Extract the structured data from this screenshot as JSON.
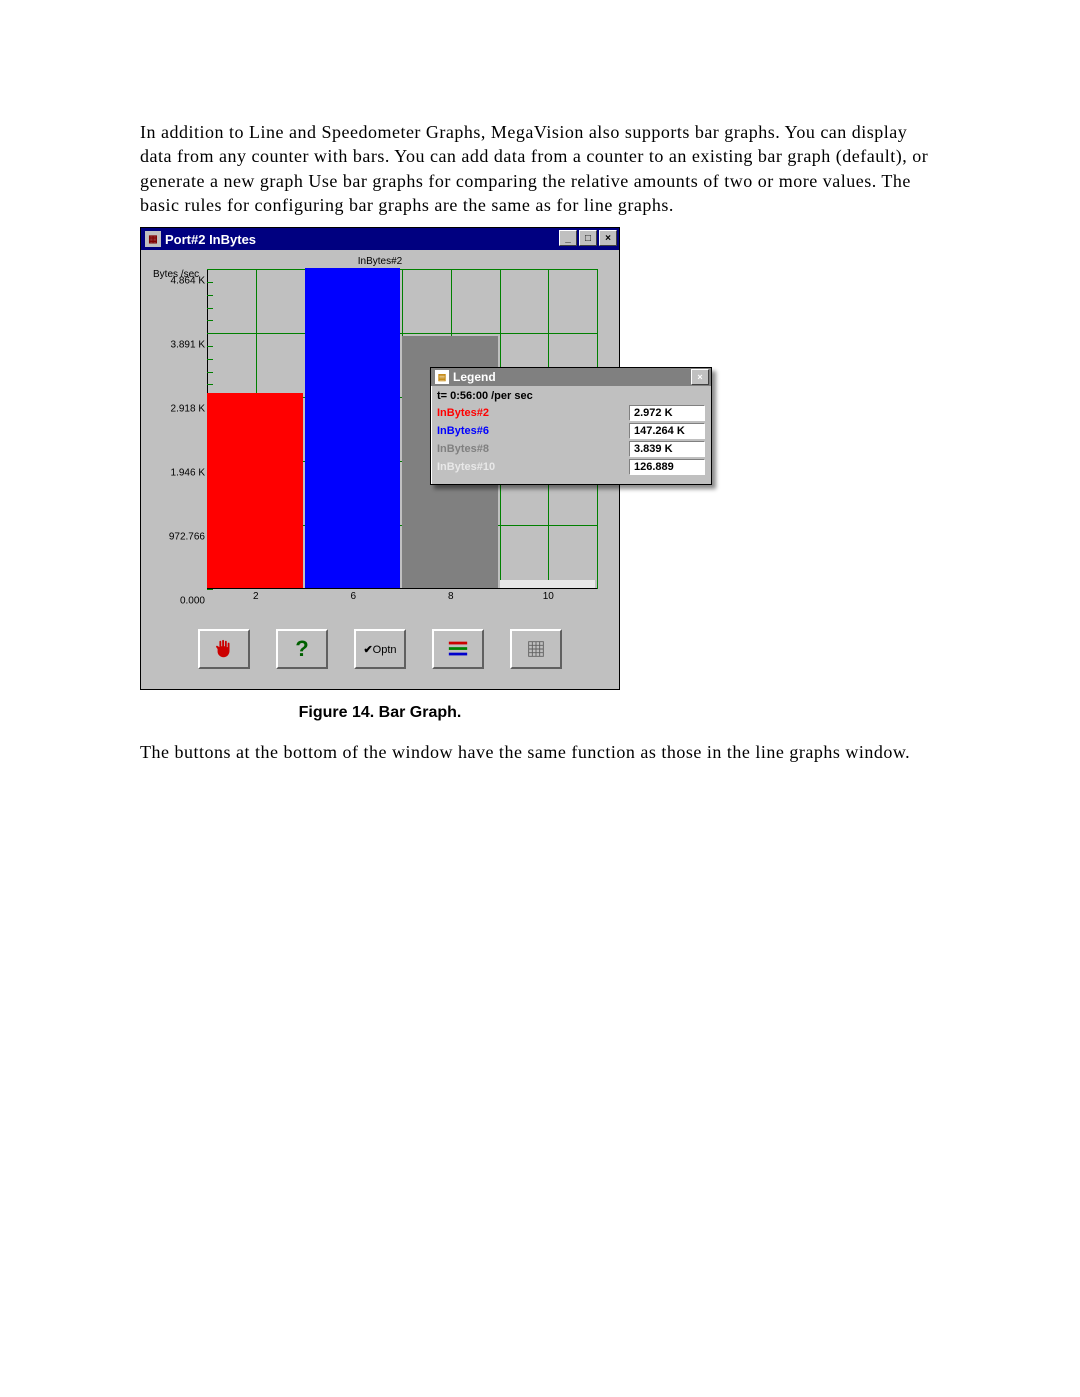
{
  "paragraph_top": "In addition to Line and Speedometer Graphs, MegaVision also supports bar graphs. You can display data from any counter with bars. You can add data from a counter to an existing bar graph (default), or generate a new graph Use bar graphs for comparing the relative amounts of two or more values. The basic rules for configuring bar graphs are the same as for line graphs.",
  "paragraph_bottom": "The buttons at the bottom of the window have the same function as those in the line graphs window.",
  "figure_caption": "Figure 14. Bar Graph.",
  "window": {
    "title": "Port#2 InBytes",
    "chart_title": "InBytes#2",
    "y_axis_label": "Bytes /sec",
    "minimize": "_",
    "maximize": "□",
    "close": "×"
  },
  "legend": {
    "title": "Legend",
    "close": "×",
    "time_line": "t=  0:56:00   /per sec",
    "rows": [
      {
        "name": "InBytes#2",
        "value": "2.972 K",
        "color": "#ff0000"
      },
      {
        "name": "InBytes#6",
        "value": "147.264 K",
        "color": "#0000ff"
      },
      {
        "name": "InBytes#8",
        "value": "3.839 K",
        "color": "#808080"
      },
      {
        "name": "InBytes#10",
        "value": "126.889",
        "color": "#e8e8e8"
      }
    ]
  },
  "toolbar": {
    "stop_label": "",
    "help_label": "?",
    "option_label": "Optn",
    "legend_label": "",
    "grid_label": ""
  },
  "chart_data": {
    "type": "bar",
    "title": "InBytes#2",
    "xlabel": "",
    "ylabel": "Bytes /sec",
    "ylim": [
      0,
      4864
    ],
    "y_ticks": [
      {
        "value": 0,
        "label": "0.000"
      },
      {
        "value": 972.766,
        "label": "972.766"
      },
      {
        "value": 1946,
        "label": "1.946 K"
      },
      {
        "value": 2918,
        "label": "2.918 K"
      },
      {
        "value": 3891,
        "label": "3.891 K"
      },
      {
        "value": 4864,
        "label": "4.864 K"
      }
    ],
    "categories": [
      "2",
      "6",
      "8",
      "10"
    ],
    "series": [
      {
        "name": "InBytes#2",
        "color": "#ff0000",
        "values": [
          2972,
          null,
          null,
          null
        ]
      },
      {
        "name": "InBytes#6",
        "color": "#0000ff",
        "values": [
          null,
          4864,
          null,
          null
        ]
      },
      {
        "name": "InBytes#8",
        "color": "#808080",
        "values": [
          null,
          null,
          3839,
          null
        ]
      },
      {
        "name": "InBytes#10",
        "color": "#e8e8e8",
        "values": [
          null,
          null,
          null,
          126.889
        ]
      }
    ],
    "x_grid_count": 8
  }
}
